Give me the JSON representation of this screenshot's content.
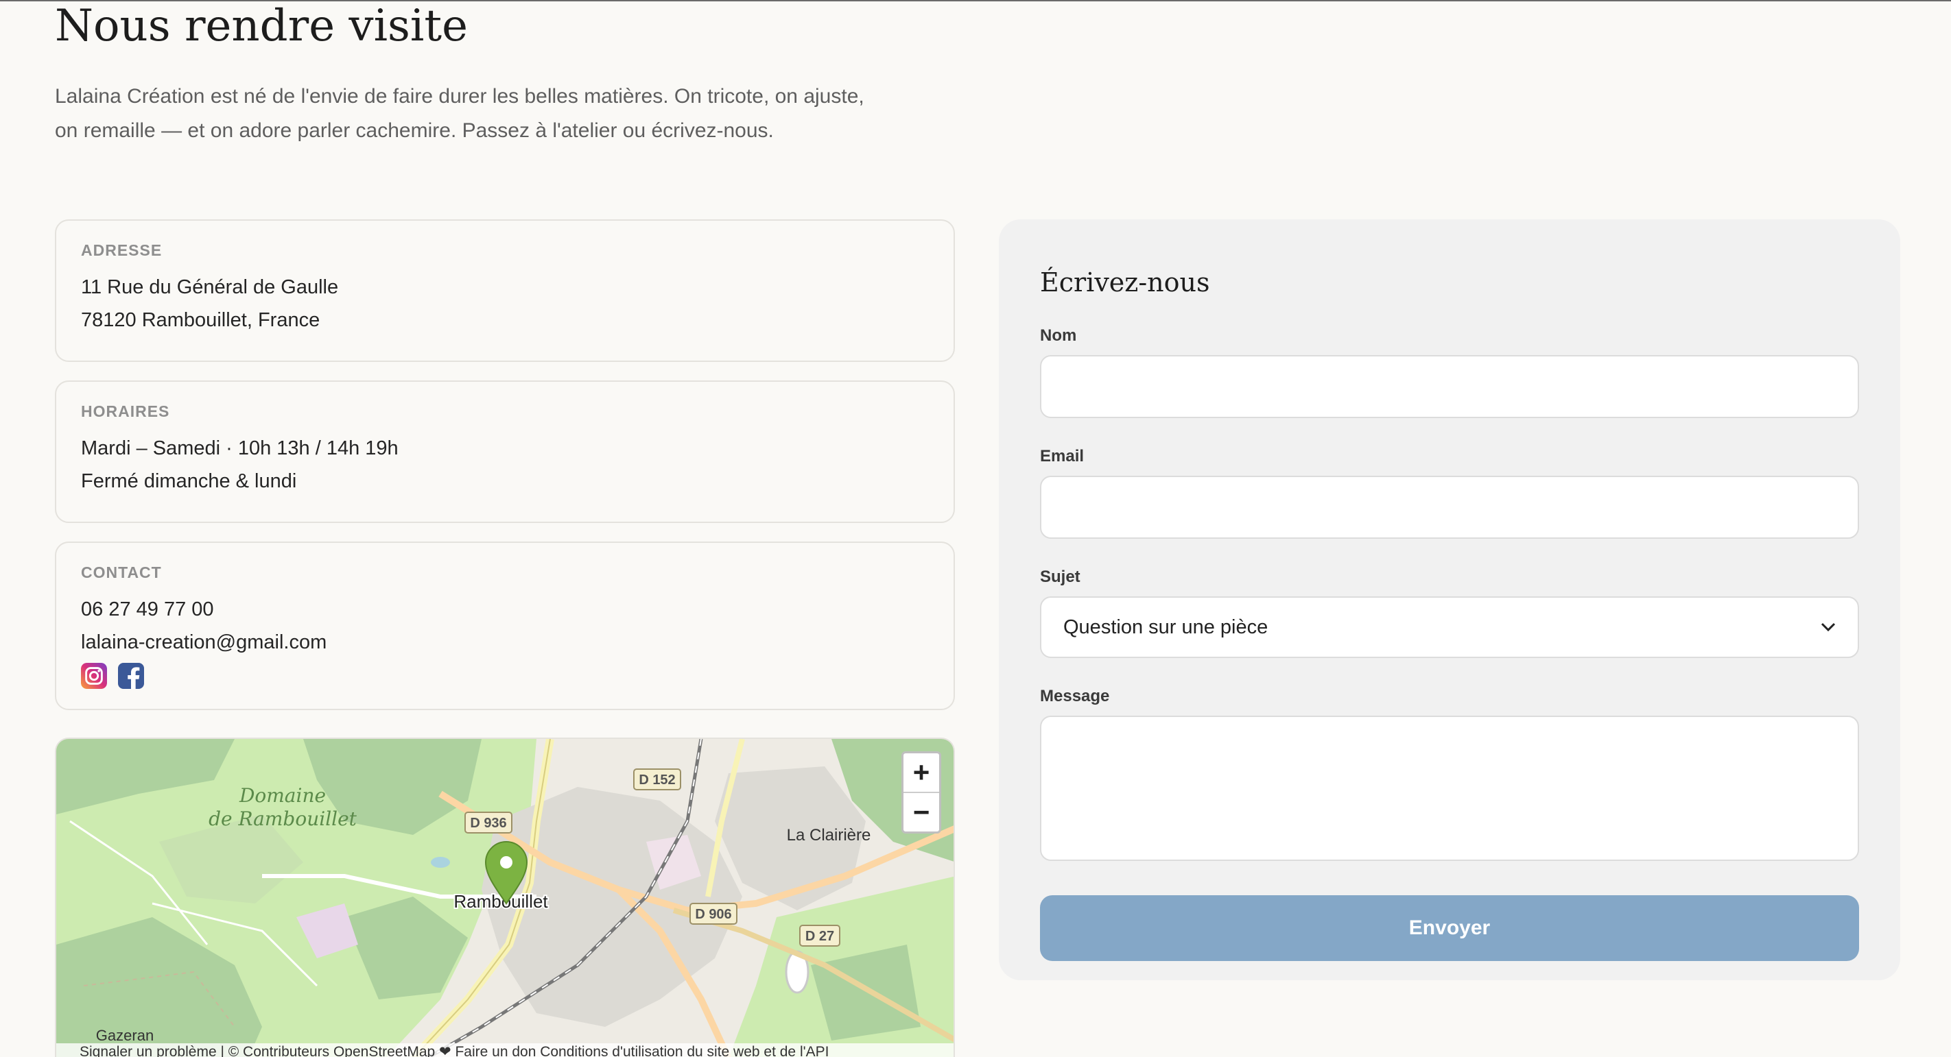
{
  "page": {
    "title": "Nous rendre visite",
    "intro": "Lalaina Création est né de l'envie de faire durer les belles matières. On tricote, on ajuste, on remaille — et on adore parler cachemire. Passez à l'atelier ou écrivez-nous."
  },
  "address": {
    "label": "ADRESSE",
    "line1": "11 Rue du Général de Gaulle",
    "line2": "78120 Rambouillet, France"
  },
  "hours": {
    "label": "HORAIRES",
    "line1": "Mardi – Samedi · 10h 13h / 14h 19h",
    "line2": "Fermé dimanche & lundi"
  },
  "contact": {
    "label": "CONTACT",
    "phone": "06 27 49 77 00",
    "email": "lalaina-creation@gmail.com",
    "social": [
      "instagram-icon",
      "facebook-icon"
    ]
  },
  "map": {
    "labels": {
      "forest_line1": "Domaine",
      "forest_line2": "de Rambouillet",
      "city": "Rambouillet",
      "clairiere": "La Clairière",
      "gazeran": "Gazeran",
      "d152": "D 152",
      "d936": "D 936",
      "d906": "D 906",
      "d27": "D 27"
    },
    "zoom_in": "+",
    "zoom_out": "−",
    "attribution": "Signaler un problème | © Contributeurs OpenStreetMap ❤ Faire un don  Conditions d'utilisation du site web et de l'API"
  },
  "form": {
    "title": "Écrivez-nous",
    "name_label": "Nom",
    "name_value": "",
    "email_label": "Email",
    "email_value": "",
    "subject_label": "Sujet",
    "subject_value": "Question sur une pièce",
    "message_label": "Message",
    "message_value": "",
    "submit_label": "Envoyer"
  },
  "colors": {
    "background": "#faf9f6",
    "form_panel": "#f1f1f1",
    "submit_button": "#84a7c7",
    "map_marker": "#7cb342"
  }
}
